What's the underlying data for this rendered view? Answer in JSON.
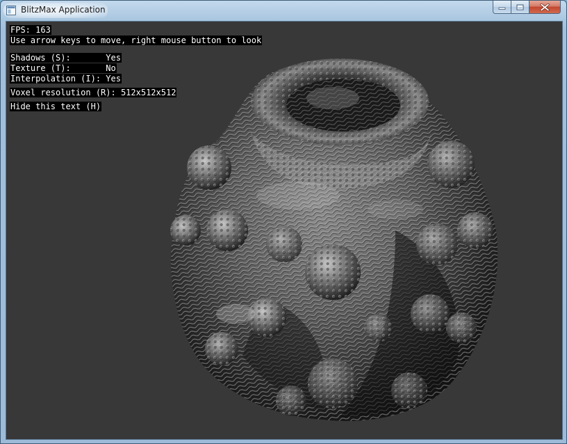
{
  "window": {
    "title": "BlitzMax Application",
    "icon": "app-window-icon",
    "controls": {
      "minimize_icon": "minimize-icon",
      "maximize_icon": "maximize-icon",
      "close_icon": "close-icon"
    }
  },
  "hud": {
    "fps_line": "FPS: 163",
    "instructions": "Use arrow keys to move, right mouse button to look",
    "shadows": "Shadows (S):       Yes",
    "texture": "Texture (T):       No",
    "interpolation": "Interpolation (I): Yes",
    "voxel_resolution": "Voxel resolution (R): 512x512x512",
    "hide_text": "Hide this text (H)"
  },
  "scene": {
    "subject": "voxel-fractal-render",
    "background_color": "#383838"
  },
  "colors": {
    "titlebar": "#a9c6e0",
    "close_button": "#c2472f",
    "hud_background": "#000000",
    "hud_text": "#ffffff"
  }
}
